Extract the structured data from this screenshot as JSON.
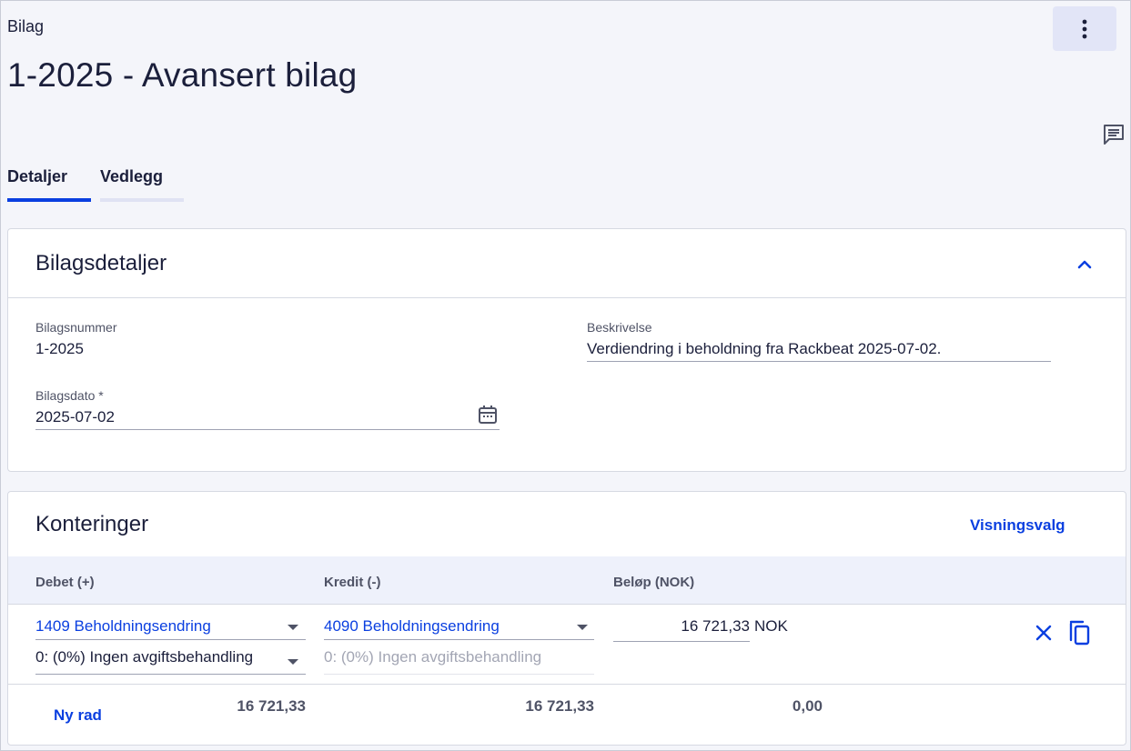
{
  "header": {
    "breadcrumb": "Bilag",
    "title": "1-2025 - Avansert bilag"
  },
  "icons": {
    "more": "more-vertical-icon",
    "comment": "comment-icon",
    "collapse": "chevron-up-icon",
    "calendar": "calendar-icon",
    "remove": "close-icon",
    "copy": "copy-icon"
  },
  "colors": {
    "accent": "#0a3fe0",
    "background": "#f4f5fa",
    "table_head": "#eef1fb"
  },
  "tabs": [
    {
      "label": "Detaljer",
      "active": true
    },
    {
      "label": "Vedlegg",
      "active": false
    }
  ],
  "details": {
    "title": "Bilagsdetaljer",
    "voucher_number_label": "Bilagsnummer",
    "voucher_number": "1-2025",
    "description_label": "Beskrivelse",
    "description": "Verdiendring i beholdning fra Rackbeat 2025-07-02.",
    "date_label": "Bilagsdato *",
    "date": "2025-07-02"
  },
  "postings": {
    "title": "Konteringer",
    "view_options": "Visningsvalg",
    "columns": {
      "debit": "Debet (+)",
      "credit": "Kredit (-)",
      "amount": "Beløp (NOK)"
    },
    "rows": [
      {
        "debit_account": "1409 Beholdningsendring",
        "debit_vat": "0: (0%) Ingen avgiftsbehandling",
        "credit_account": "4090 Beholdningsendring",
        "credit_vat": "0: (0%) Ingen avgiftsbehandling",
        "amount": "16 721,33",
        "currency": "NOK"
      }
    ],
    "totals": {
      "debit": "16 721,33",
      "credit": "16 721,33",
      "difference": "0,00"
    },
    "new_row": "Ny rad"
  }
}
